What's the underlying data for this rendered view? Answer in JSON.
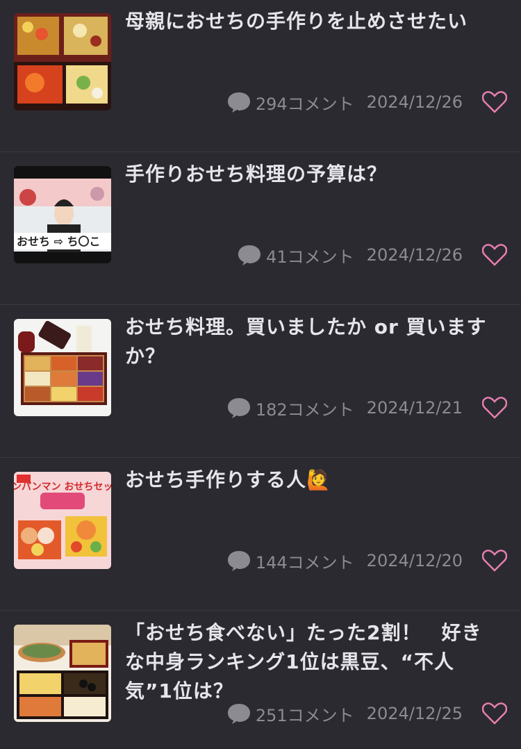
{
  "articles": [
    {
      "title": "母親におせちの手作りを止めさせたい",
      "comments": "294コメント",
      "date": "2024/12/26",
      "thumb_icon": "osechi-jubako-photo"
    },
    {
      "title": "手作りおせち料理の予算は？",
      "comments": "41コメント",
      "date": "2024/12/26",
      "thumb_icon": "tv-show-screenshot",
      "thumb_caption": "おせち ⇨ ち〇こ"
    },
    {
      "title": "おせち料理。買いましたか or 買いますか？",
      "comments": "182コメント",
      "date": "2024/12/21",
      "thumb_icon": "osechi-box-with-wine-photo"
    },
    {
      "title": "おせち手作りする人🙋",
      "comments": "144コメント",
      "date": "2024/12/20",
      "thumb_icon": "anpanman-osechi-set-ad",
      "thumb_caption": "アンパンマン おせちセット"
    },
    {
      "title": "「おせち食べない」たった2割！　好きな中身ランキング1位は黒豆、“不人気”1位は？",
      "comments": "251コメント",
      "date": "2024/12/25",
      "thumb_icon": "osechi-dishes-photo"
    }
  ],
  "colors": {
    "background": "#2b2a31",
    "title": "#e6e6ea",
    "meta": "#8c8b92",
    "heart": "#e77fb0"
  }
}
